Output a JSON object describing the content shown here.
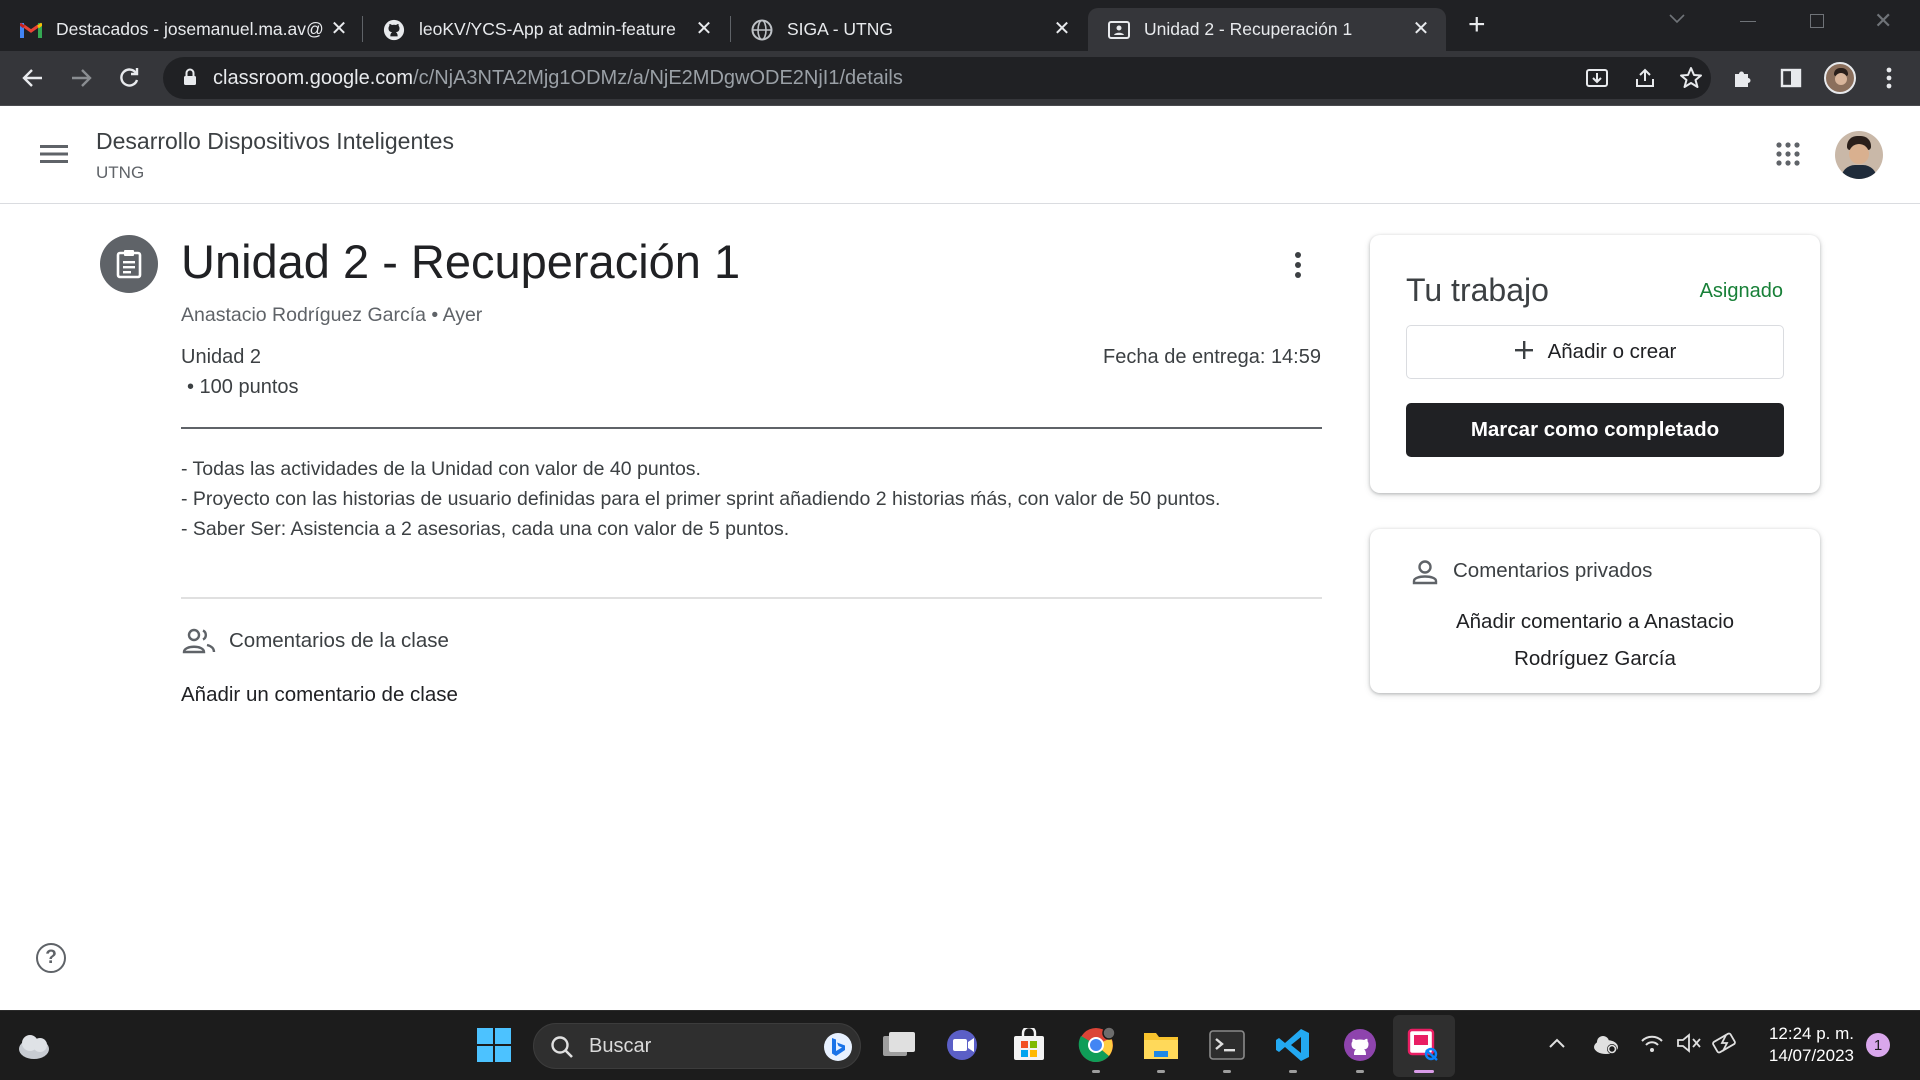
{
  "browser": {
    "tabs": [
      {
        "title": "Destacados - josemanuel.ma.av@",
        "favicon": "gmail-icon"
      },
      {
        "title": "leoKV/YCS-App at admin-feature",
        "favicon": "github-icon"
      },
      {
        "title": "SIGA - UTNG",
        "favicon": "globe-icon"
      },
      {
        "title": "Unidad 2 - Recuperación 1",
        "favicon": "classroom-icon"
      }
    ],
    "url_host": "classroom.google.com",
    "url_path": "/c/NjA3NTA2Mjg1ODMz/a/NjE2MDgwODE2NjI1/details"
  },
  "header": {
    "class_name": "Desarrollo Dispositivos Inteligentes",
    "section": "UTNG"
  },
  "assignment": {
    "title": "Unidad 2 - Recuperación 1",
    "author": "Anastacio Rodríguez García",
    "date": "Ayer",
    "separator": "•",
    "topic": "Unidad 2",
    "points": "• 100 puntos",
    "due": "Fecha de entrega: 14:59",
    "description": [
      "- Todas las actividades de la Unidad con valor de 40 puntos.",
      "- Proyecto con las historias de usuario definidas para el primer sprint añadiendo 2 historias ḿás, con valor de 50 puntos.",
      "- Saber Ser: Asistencia a 2 asesorias, cada una con valor de 5 puntos."
    ]
  },
  "class_comments": {
    "label": "Comentarios de la clase",
    "add": "Añadir un comentario de clase"
  },
  "your_work": {
    "title": "Tu trabajo",
    "status": "Asignado",
    "add_create": "Añadir o crear",
    "mark_done": "Marcar como completado"
  },
  "private_comments": {
    "label": "Comentarios privados",
    "add": "Añadir comentario a Anastacio Rodríguez García"
  },
  "taskbar": {
    "search_placeholder": "Buscar",
    "time": "12:24 p. m.",
    "date": "14/07/2023",
    "notification_count": "1"
  },
  "colors": {
    "accent_green": "#188038",
    "button_dark": "#202124",
    "chrome_dark": "#202124"
  }
}
